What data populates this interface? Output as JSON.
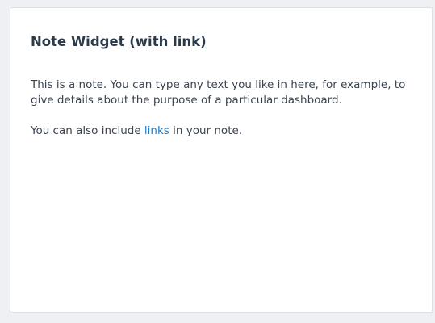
{
  "widget": {
    "title": "Note Widget (with link)",
    "paragraph_1": "This is a note. You can type any text you like in here, for example, to give details about the purpose of a particular dashboard.",
    "paragraph_2_before": "You can also include ",
    "link_label": "links",
    "paragraph_2_after": " in your note.",
    "colors": {
      "title": "#2b3a4a",
      "text": "#3a4450",
      "link": "#1f7ac9",
      "background": "#ffffff",
      "page": "#eef0f3"
    }
  }
}
